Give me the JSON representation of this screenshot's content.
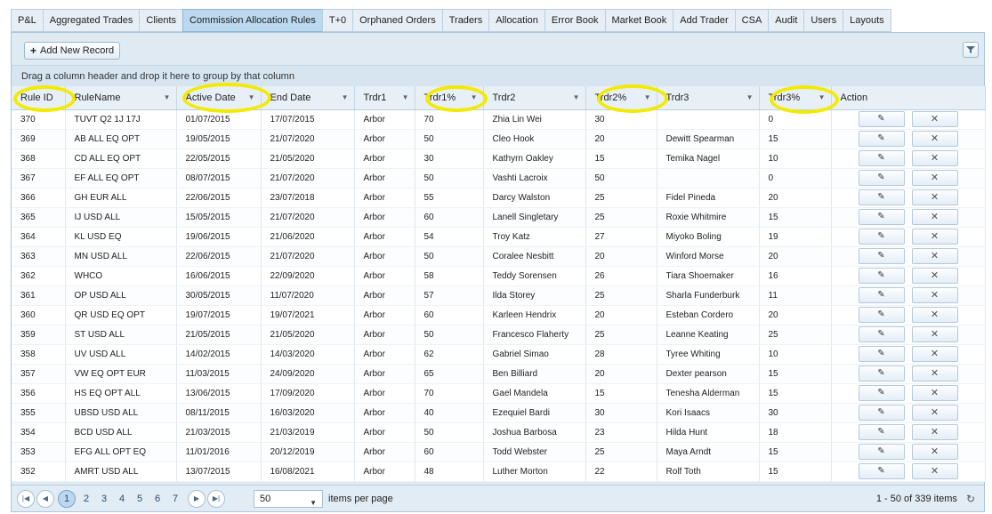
{
  "tabs": [
    "P&L",
    "Aggregated Trades",
    "Clients",
    "Commission Allocation Rules",
    "T+0",
    "Orphaned Orders",
    "Traders",
    "Allocation",
    "Error Book",
    "Market Book",
    "Add Trader",
    "CSA",
    "Audit",
    "Users",
    "Layouts"
  ],
  "active_tab": "Commission Allocation Rules",
  "toolbar": {
    "add_label": "Add New Record",
    "plus": "+"
  },
  "group_hint": "Drag a column header and drop it here to group by that column",
  "columns": [
    "Rule ID",
    "RuleName",
    "Active Date",
    "End Date",
    "Trdr1",
    "Trdr1%",
    "Trdr2",
    "Trdr2%",
    "Trdr3",
    "Trdr3%",
    "Action"
  ],
  "rows": [
    [
      "370",
      "TUVT Q2 1J 17J",
      "01/07/2015",
      "17/07/2015",
      "Arbor",
      "70",
      "Zhia Lin Wei",
      "30",
      "",
      "0"
    ],
    [
      "369",
      "AB ALL EQ OPT",
      "19/05/2015",
      "21/07/2020",
      "Arbor",
      "50",
      "Cleo Hook",
      "20",
      "Dewitt Spearman",
      "15"
    ],
    [
      "368",
      "CD ALL EQ OPT",
      "22/05/2015",
      "21/05/2020",
      "Arbor",
      "30",
      "Kathyrn Oakley",
      "15",
      "Temika Nagel",
      "10"
    ],
    [
      "367",
      "EF ALL EQ OPT",
      "08/07/2015",
      "21/07/2020",
      "Arbor",
      "50",
      "Vashti Lacroix",
      "50",
      "",
      "0"
    ],
    [
      "366",
      "GH EUR ALL",
      "22/06/2015",
      "23/07/2018",
      "Arbor",
      "55",
      "Darcy Walston",
      "25",
      "Fidel Pineda",
      "20"
    ],
    [
      "365",
      "IJ USD ALL",
      "15/05/2015",
      "21/07/2020",
      "Arbor",
      "60",
      "Lanell Singletary",
      "25",
      "Roxie Whitmire",
      "15"
    ],
    [
      "364",
      "KL USD EQ",
      "19/06/2015",
      "21/06/2020",
      "Arbor",
      "54",
      "Troy Katz",
      "27",
      "Miyoko Boling",
      "19"
    ],
    [
      "363",
      "MN USD ALL",
      "22/06/2015",
      "21/07/2020",
      "Arbor",
      "50",
      "Coralee Nesbitt",
      "20",
      "Winford Morse",
      "20"
    ],
    [
      "362",
      "WHCO",
      "16/06/2015",
      "22/09/2020",
      "Arbor",
      "58",
      "Teddy Sorensen",
      "26",
      "Tiara Shoemaker",
      "16"
    ],
    [
      "361",
      "OP USD ALL",
      "30/05/2015",
      "11/07/2020",
      "Arbor",
      "57",
      "Ilda Storey",
      "25",
      "Sharla Funderburk",
      "11"
    ],
    [
      "360",
      "QR USD EQ OPT",
      "19/07/2015",
      "19/07/2021",
      "Arbor",
      "60",
      "Karleen Hendrix",
      "20",
      "Esteban Cordero",
      "20"
    ],
    [
      "359",
      "ST USD ALL",
      "21/05/2015",
      "21/05/2020",
      "Arbor",
      "50",
      "Francesco Flaherty",
      "25",
      "Leanne Keating",
      "25"
    ],
    [
      "358",
      "UV USD ALL",
      "14/02/2015",
      "14/03/2020",
      "Arbor",
      "62",
      "Gabriel Simao",
      "28",
      "Tyree Whiting",
      "10"
    ],
    [
      "357",
      "VW EQ OPT EUR",
      "11/03/2015",
      "24/09/2020",
      "Arbor",
      "65",
      "Ben Billiard",
      "20",
      "Dexter pearson",
      "15"
    ],
    [
      "356",
      "HS EQ OPT ALL",
      "13/06/2015",
      "17/09/2020",
      "Arbor",
      "70",
      "Gael Mandela",
      "15",
      "Tenesha Alderman",
      "15"
    ],
    [
      "355",
      "UBSD USD ALL",
      "08/11/2015",
      "16/03/2020",
      "Arbor",
      "40",
      "Ezequiel Bardi",
      "30",
      "Kori Isaacs",
      "30"
    ],
    [
      "354",
      "BCD USD ALL",
      "21/03/2015",
      "21/03/2019",
      "Arbor",
      "50",
      "Joshua Barbosa",
      "23",
      "Hilda Hunt",
      "18"
    ],
    [
      "353",
      "EFG ALL OPT EQ",
      "11/01/2016",
      "20/12/2019",
      "Arbor",
      "60",
      "Todd Webster",
      "25",
      "Maya Arndt",
      "15"
    ],
    [
      "352",
      "AMRT USD ALL",
      "13/07/2015",
      "16/08/2021",
      "Arbor",
      "48",
      "Luther Morton",
      "22",
      "Rolf Toth",
      "15"
    ]
  ],
  "action": {
    "edit_icon": "pencil-icon",
    "edit_glyph": "✎",
    "delete_icon": "close-icon",
    "delete_glyph": "✕"
  },
  "pager": {
    "pages": [
      "1",
      "2",
      "3",
      "4",
      "5",
      "6",
      "7"
    ],
    "current_page": "1",
    "page_size": "50",
    "items_label": "items per page",
    "info": "1 - 50 of 339 items"
  },
  "colors": {
    "highlight": "#f2ea00",
    "active_tab": "#bcd8ee",
    "panel": "#dfeaf3"
  }
}
